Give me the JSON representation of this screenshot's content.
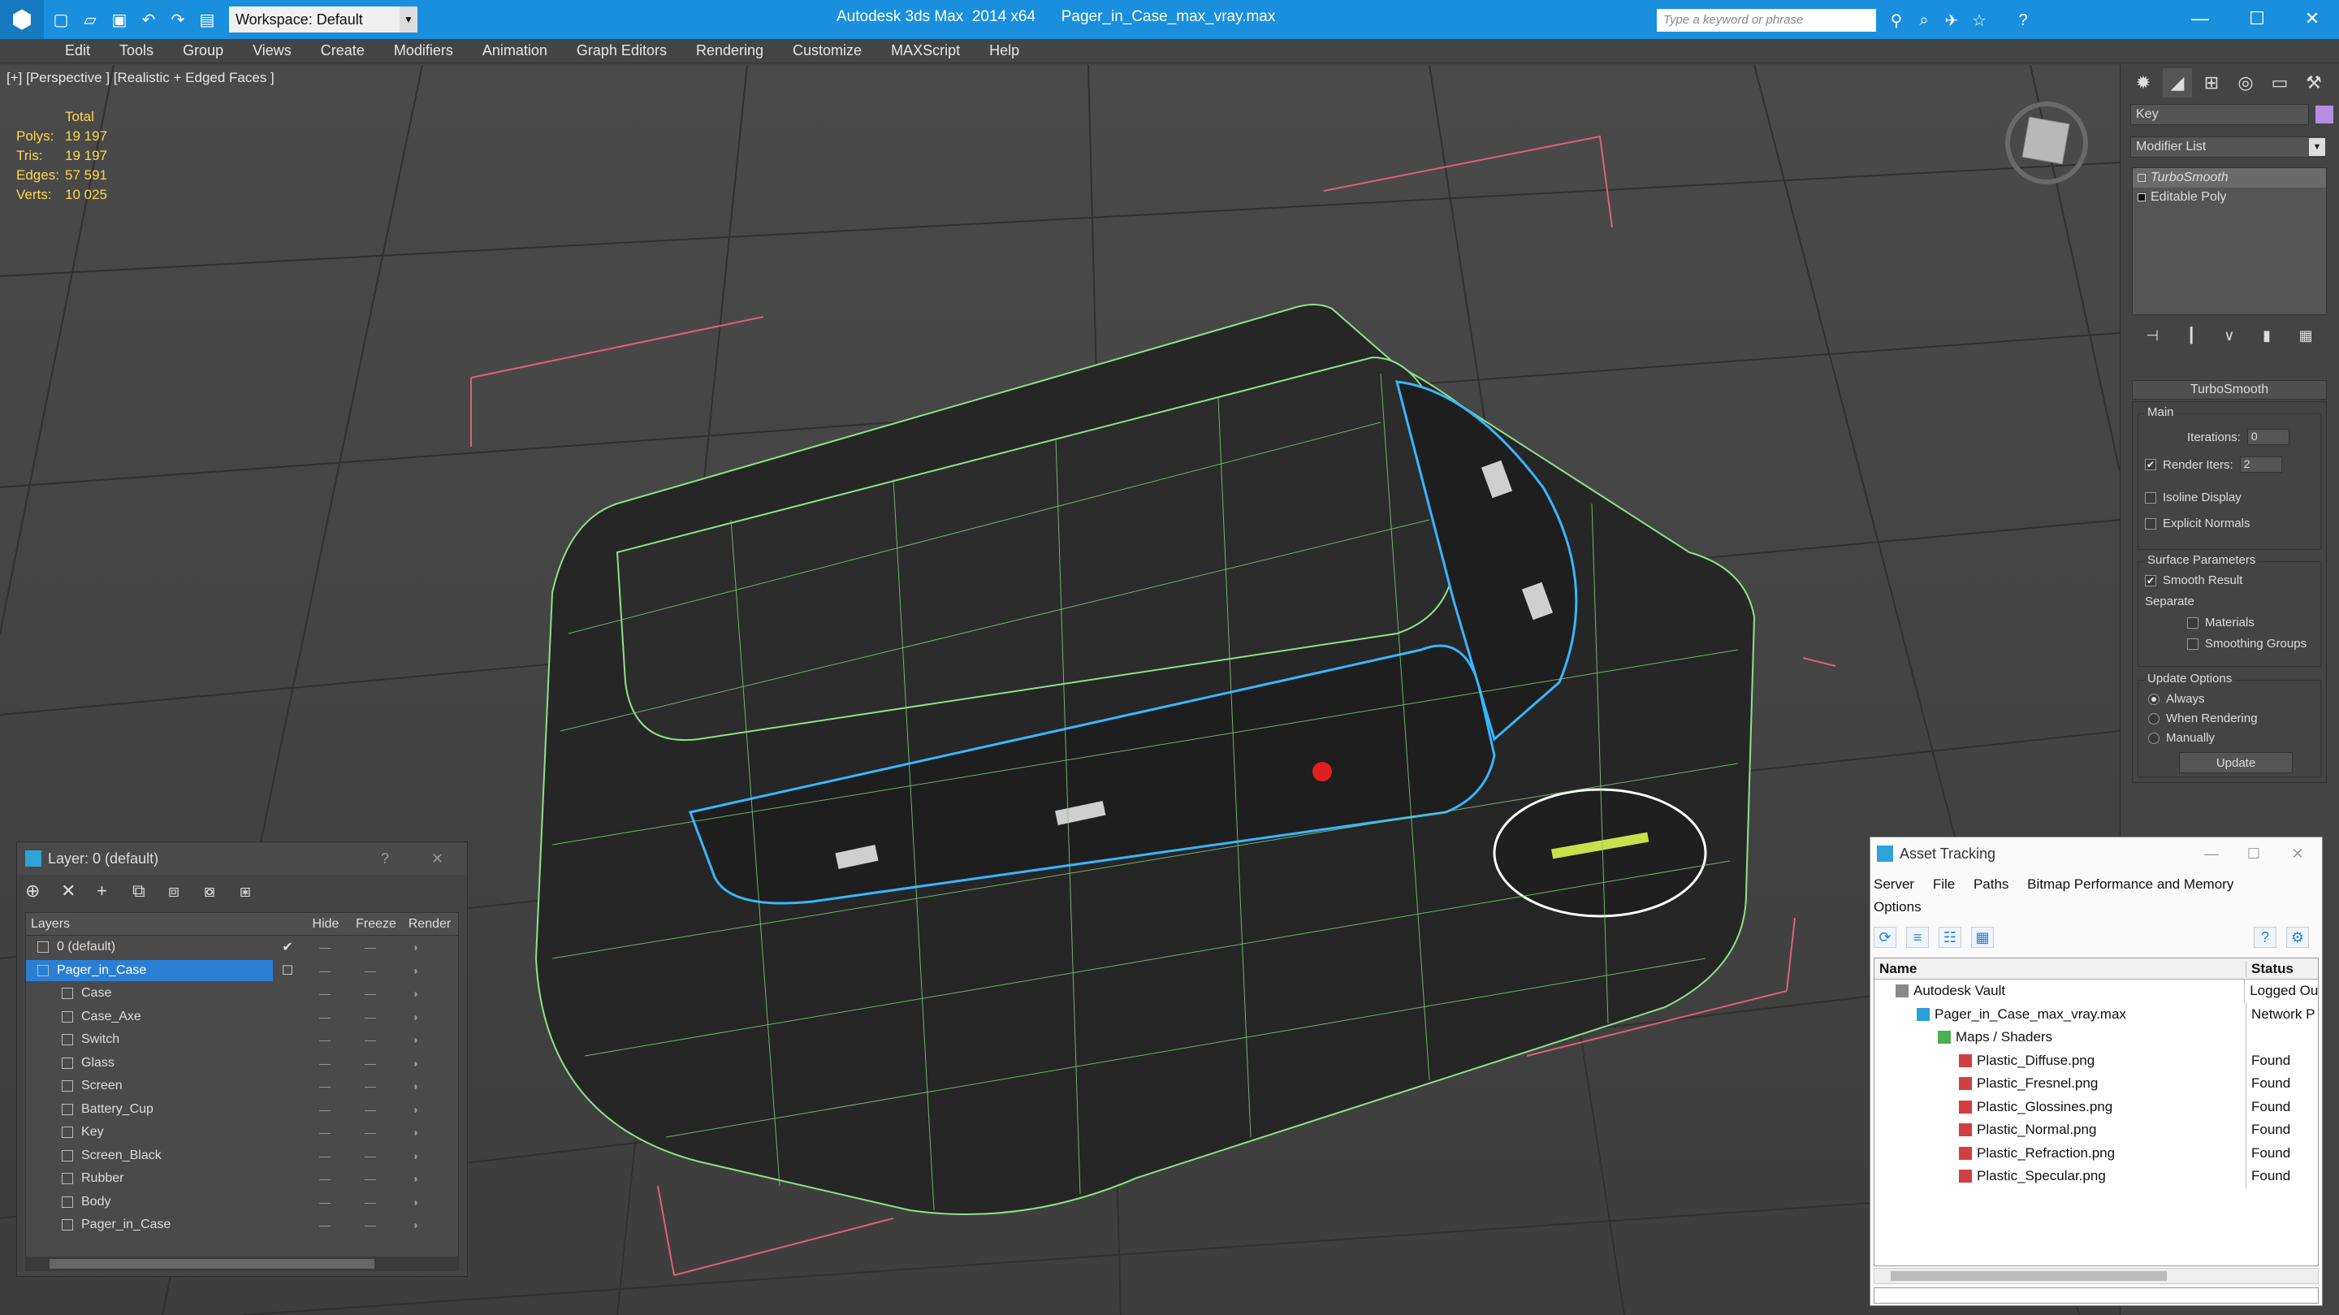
{
  "titlebar": {
    "workspace": "Workspace: Default",
    "title": "Autodesk 3ds Max  2014 x64      Pager_in_Case_max_vray.max",
    "search_placeholder": "Type a keyword or phrase"
  },
  "menu": [
    "Edit",
    "Tools",
    "Group",
    "Views",
    "Create",
    "Modifiers",
    "Animation",
    "Graph Editors",
    "Rendering",
    "Customize",
    "MAXScript",
    "Help"
  ],
  "viewport": {
    "label": "[+] [Perspective ] [Realistic + Edged Faces ]",
    "stats": {
      "total": "Total",
      "polys_label": "Polys:",
      "polys": "19 197",
      "tris_label": "Tris:",
      "tris": "19 197",
      "edges_label": "Edges:",
      "edges": "57 591",
      "verts_label": "Verts:",
      "verts": "10 025"
    }
  },
  "command_panel": {
    "object_name": "Key",
    "modifier_list": "Modifier List",
    "stack": [
      "TurboSmooth",
      "Editable Poly"
    ],
    "rollout_title": "TurboSmooth",
    "main_group": "Main",
    "iterations_label": "Iterations:",
    "iterations": "0",
    "render_iters_label": "Render Iters:",
    "render_iters": "2",
    "isoline": "Isoline Display",
    "explicit_normals": "Explicit Normals",
    "surface_group": "Surface Parameters",
    "smooth_result": "Smooth Result",
    "separate": "Separate",
    "materials": "Materials",
    "smoothing_groups": "Smoothing Groups",
    "update_group": "Update Options",
    "always": "Always",
    "when_rendering": "When Rendering",
    "manually": "Manually",
    "update": "Update"
  },
  "layer_panel": {
    "title": "Layer: 0 (default)",
    "help": "?",
    "columns": {
      "layers": "Layers",
      "hide": "Hide",
      "freeze": "Freeze",
      "render": "Render"
    },
    "rows": [
      {
        "name": "0 (default)",
        "level": 0
      },
      {
        "name": "Pager_in_Case",
        "level": 0
      },
      {
        "name": "Case",
        "level": 1
      },
      {
        "name": "Case_Axe",
        "level": 1
      },
      {
        "name": "Switch",
        "level": 1
      },
      {
        "name": "Glass",
        "level": 1
      },
      {
        "name": "Screen",
        "level": 1
      },
      {
        "name": "Battery_Cup",
        "level": 1
      },
      {
        "name": "Key",
        "level": 1
      },
      {
        "name": "Screen_Black",
        "level": 1
      },
      {
        "name": "Rubber",
        "level": 1
      },
      {
        "name": "Body",
        "level": 1
      },
      {
        "name": "Pager_in_Case",
        "level": 1
      }
    ]
  },
  "asset_panel": {
    "title": "Asset Tracking",
    "menu": [
      "Server",
      "File",
      "Paths",
      "Bitmap Performance and Memory",
      "Options"
    ],
    "columns": {
      "name": "Name",
      "status": "Status"
    },
    "rows": [
      {
        "name": "Autodesk Vault",
        "status": "Logged Ou",
        "level": 1
      },
      {
        "name": "Pager_in_Case_max_vray.max",
        "status": "Network P",
        "level": 2
      },
      {
        "name": "Maps / Shaders",
        "status": "",
        "level": 3
      },
      {
        "name": "Plastic_Diffuse.png",
        "status": "Found",
        "level": 4
      },
      {
        "name": "Plastic_Fresnel.png",
        "status": "Found",
        "level": 4
      },
      {
        "name": "Plastic_Glossines.png",
        "status": "Found",
        "level": 4
      },
      {
        "name": "Plastic_Normal.png",
        "status": "Found",
        "level": 4
      },
      {
        "name": "Plastic_Refraction.png",
        "status": "Found",
        "level": 4
      },
      {
        "name": "Plastic_Specular.png",
        "status": "Found",
        "level": 4
      }
    ]
  },
  "colors": {
    "titlebar": "#1a8fdd",
    "selection": "#2a7fd4",
    "wire": "#8fe08a",
    "selected_wire": "#38b6ff",
    "stats": "#ffd84a"
  }
}
